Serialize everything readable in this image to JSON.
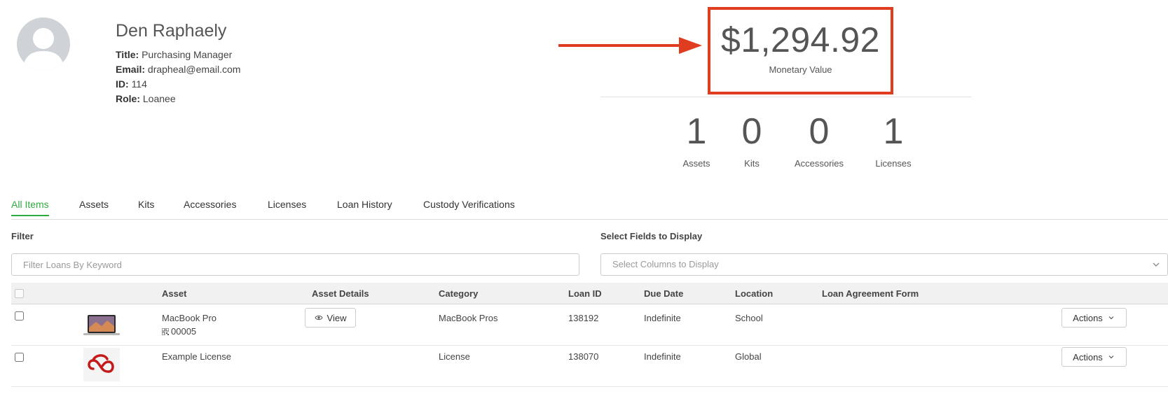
{
  "profile": {
    "name": "Den Raphaely",
    "title_label": "Title:",
    "title": "Purchasing Manager",
    "email_label": "Email:",
    "email": "drapheal@email.com",
    "id_label": "ID:",
    "id": "114",
    "role_label": "Role:",
    "role": "Loanee"
  },
  "summary": {
    "monetary_value": "$1,294.92",
    "monetary_label": "Monetary Value",
    "highlight_color": "#e03c1f",
    "stats": [
      {
        "value": "1",
        "label": "Assets"
      },
      {
        "value": "0",
        "label": "Kits"
      },
      {
        "value": "0",
        "label": "Accessories"
      },
      {
        "value": "1",
        "label": "Licenses"
      }
    ]
  },
  "tabs": [
    {
      "label": "All Items",
      "active": true
    },
    {
      "label": "Assets"
    },
    {
      "label": "Kits"
    },
    {
      "label": "Accessories"
    },
    {
      "label": "Licenses"
    },
    {
      "label": "Loan History"
    },
    {
      "label": "Custody Verifications"
    }
  ],
  "accent_color": "#2eab3e",
  "filter": {
    "label": "Filter",
    "placeholder": "Filter Loans By Keyword"
  },
  "fields": {
    "label": "Select Fields to Display",
    "placeholder": "Select Columns to Display"
  },
  "table": {
    "columns": [
      "Asset",
      "Asset Details",
      "Category",
      "Loan ID",
      "Due Date",
      "Location",
      "Loan Agreement Form"
    ],
    "rows": [
      {
        "asset": "MacBook Pro",
        "asset_id": "00005",
        "details_button": "View",
        "category": "MacBook Pros",
        "loan_id": "138192",
        "due_date": "Indefinite",
        "location": "School",
        "actions": "Actions",
        "thumbnail": "laptop-thumbnail"
      },
      {
        "asset": "Example License",
        "category": "License",
        "loan_id": "138070",
        "due_date": "Indefinite",
        "location": "Global",
        "actions": "Actions",
        "thumbnail": "creative-cloud-logo"
      }
    ]
  }
}
